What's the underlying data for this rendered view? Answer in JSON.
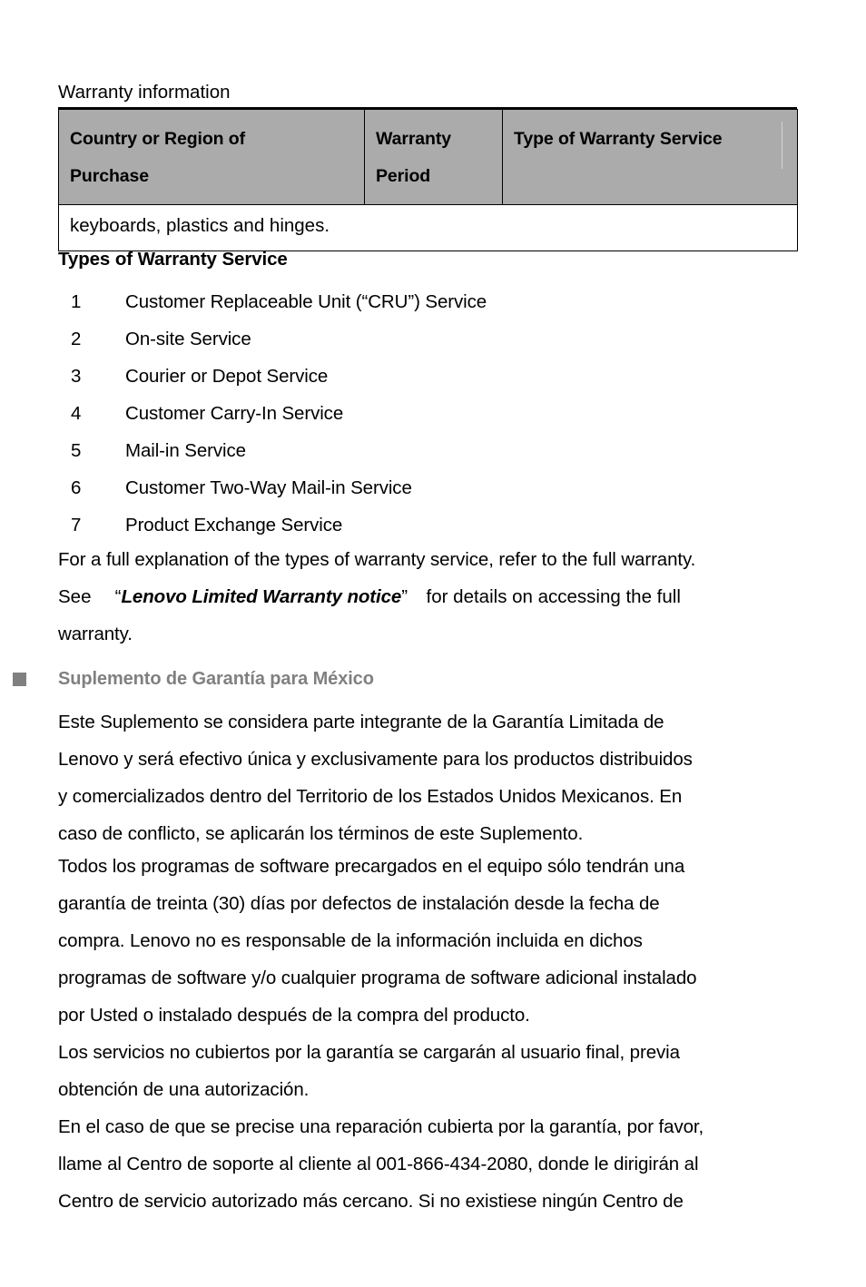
{
  "document": {
    "heading": "Warranty information"
  },
  "warranty_table": {
    "headers": [
      "Country or Region of Purchase",
      "Warranty Period",
      "Type of Warranty Service"
    ],
    "header_col1_line1": "Country or Region of",
    "header_col1_line2": "Purchase",
    "header_col2_line1": "Warranty",
    "header_col2_line2": "Period",
    "header_col3_line1": "Type of Warranty Service",
    "body_row": "keyboards, plastics and hinges.",
    "header_background": "#ababab",
    "border_color": "#000000"
  },
  "service_types": {
    "title": "Types of Warranty Service",
    "items": [
      {
        "number": "1",
        "label": "Customer Replaceable Unit (“CRU”) Service"
      },
      {
        "number": "2",
        "label": "On-site Service"
      },
      {
        "number": "3",
        "label": "Courier or Depot Service"
      },
      {
        "number": "4",
        "label": "Customer Carry-In Service"
      },
      {
        "number": "5",
        "label": "Mail-in Service"
      },
      {
        "number": "6",
        "label": "Customer Two-Way Mail-in Service"
      },
      {
        "number": "7",
        "label": "Product Exchange Service"
      }
    ]
  },
  "full_explanation": {
    "line1": "For a full explanation of the types of warranty service, refer to the full warranty.",
    "line2_prefix": "See 　“",
    "line2_emphasis": "Lenovo Limited Warranty notice",
    "line2_suffix": "”　for details on accessing the full",
    "line3": "warranty."
  },
  "mexico_supplement": {
    "bullet_icon": "square-bullet-icon",
    "heading": "Suplemento de Garantía para México",
    "heading_color": "#808080",
    "paragraph1": [
      "Este Suplemento se considera parte integrante de la Garantía Limitada de",
      "Lenovo y será efectivo única y exclusivamente para los productos distribuidos",
      "y comercializados dentro del Territorio de los Estados Unidos Mexicanos. En",
      "caso de conflicto, se aplicarán los términos de este Suplemento."
    ],
    "paragraph2": [
      "Todos los programas de software precargados en el equipo sólo tendrán una",
      "garantía de treinta (30) días por defectos de instalación desde la fecha de",
      "compra. Lenovo no es responsable de la información incluida en dichos",
      "programas de software y/o cualquier programa de software adicional instalado",
      "por Usted o instalado después de la compra del producto."
    ],
    "paragraph3": [
      "Los servicios no cubiertos por la garantía se cargarán al usuario final, previa",
      "obtención de una autorización."
    ],
    "paragraph4": [
      "En el caso de que se precise una reparación cubierta por la garantía, por favor,",
      "llame al Centro de soporte al cliente al 001-866-434-2080, donde le dirigirán al",
      "Centro de servicio autorizado más cercano. Si no existiese ningún Centro de"
    ],
    "support_phone": "001-866-434-2080"
  }
}
